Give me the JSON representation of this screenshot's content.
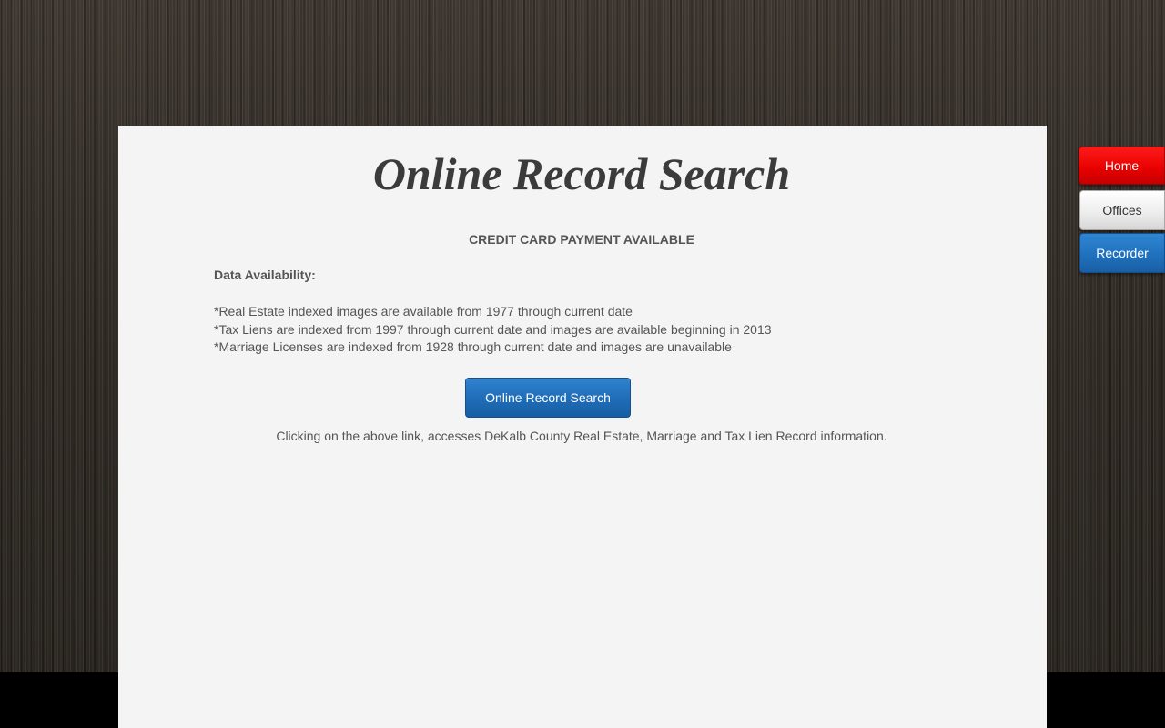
{
  "title": "Online Record Search",
  "notice": "CREDIT CARD PAYMENT AVAILABLE",
  "availability": {
    "heading": "Data Availability:",
    "items": [
      "*Real Estate indexed images are available from 1977 through current date",
      "*Tax Liens are indexed from 1997 through current date and images are available beginning in 2013",
      "*Marriage Licenses are indexed from 1928 through current date and images are unavailable"
    ]
  },
  "search_button": {
    "label": "Online Record Search",
    "color": "#1f6cb7"
  },
  "disclaimer": "Clicking on the above link, accesses DeKalb County Real Estate, Marriage and Tax Lien Record information.",
  "nav": {
    "items": [
      {
        "label": "Home",
        "color": "#e60000"
      },
      {
        "label": "Offices",
        "color": "#ececec"
      },
      {
        "label": "Recorder",
        "color": "#1f6fbb"
      }
    ]
  }
}
